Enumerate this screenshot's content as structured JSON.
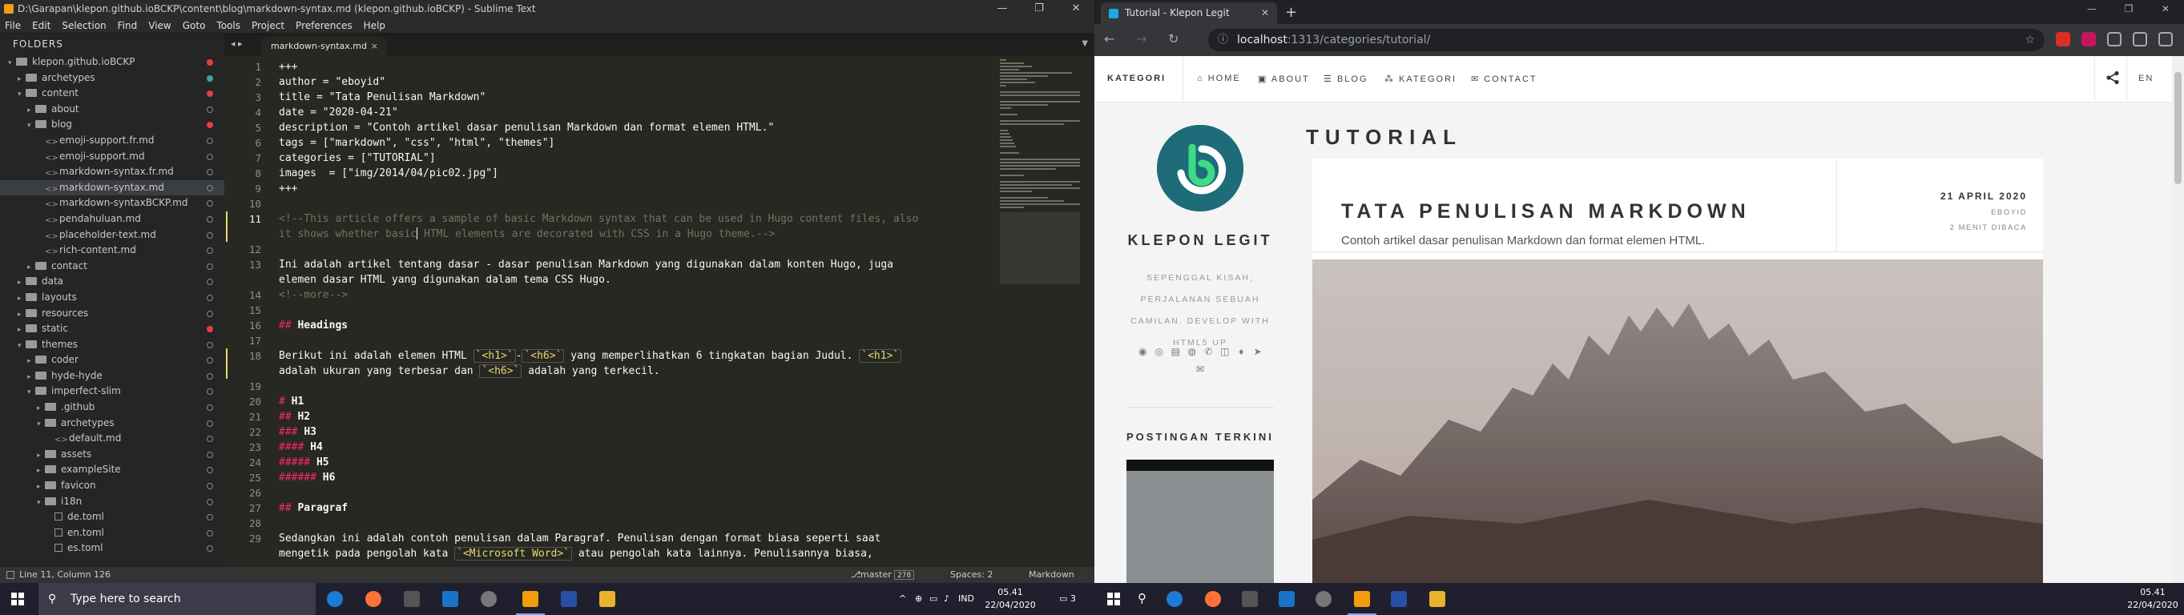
{
  "sublime": {
    "title": "D:\\Garapan\\klepon.github.ioBCKP\\content\\blog\\markdown-syntax.md (klepon.github.ioBCKP) - Sublime Text",
    "window_buttons": [
      "—",
      "❐",
      "✕"
    ],
    "menu": [
      "File",
      "Edit",
      "Selection",
      "Find",
      "View",
      "Goto",
      "Tools",
      "Project",
      "Preferences",
      "Help"
    ],
    "sidebar_header": "FOLDERS",
    "tree": [
      {
        "label": "klepon.github.ioBCKP",
        "kind": "folder",
        "depth": 0,
        "open": true,
        "dot": "red"
      },
      {
        "label": "archetypes",
        "kind": "folder",
        "depth": 1,
        "open": false,
        "dot": "teal"
      },
      {
        "label": "content",
        "kind": "folder",
        "depth": 1,
        "open": true,
        "dot": "red"
      },
      {
        "label": "about",
        "kind": "folder",
        "depth": 2,
        "open": false,
        "dot": "ring"
      },
      {
        "label": "blog",
        "kind": "folder",
        "depth": 2,
        "open": true,
        "dot": "red"
      },
      {
        "label": "emoji-support.fr.md",
        "kind": "file",
        "depth": 3,
        "dot": "ring"
      },
      {
        "label": "emoji-support.md",
        "kind": "file",
        "depth": 3,
        "dot": "ring"
      },
      {
        "label": "markdown-syntax.fr.md",
        "kind": "file",
        "depth": 3,
        "dot": "ring"
      },
      {
        "label": "markdown-syntax.md",
        "kind": "file",
        "depth": 3,
        "dot": "ring",
        "selected": true
      },
      {
        "label": "markdown-syntaxBCKP.md",
        "kind": "file",
        "depth": 3,
        "dot": "ring"
      },
      {
        "label": "pendahuluan.md",
        "kind": "file",
        "depth": 3,
        "dot": "ring"
      },
      {
        "label": "placeholder-text.md",
        "kind": "file",
        "depth": 3,
        "dot": "ring"
      },
      {
        "label": "rich-content.md",
        "kind": "file",
        "depth": 3,
        "dot": "ring"
      },
      {
        "label": "contact",
        "kind": "folder",
        "depth": 2,
        "open": false,
        "dot": "ring"
      },
      {
        "label": "data",
        "kind": "folder",
        "depth": 1,
        "open": false,
        "dot": "ring"
      },
      {
        "label": "layouts",
        "kind": "folder",
        "depth": 1,
        "open": false,
        "dot": "ring"
      },
      {
        "label": "resources",
        "kind": "folder",
        "depth": 1,
        "open": false,
        "dot": "ring"
      },
      {
        "label": "static",
        "kind": "folder",
        "depth": 1,
        "open": false,
        "dot": "red"
      },
      {
        "label": "themes",
        "kind": "folder",
        "depth": 1,
        "open": true,
        "dot": "ring"
      },
      {
        "label": "coder",
        "kind": "folder",
        "depth": 2,
        "open": false,
        "dot": "ring"
      },
      {
        "label": "hyde-hyde",
        "kind": "folder",
        "depth": 2,
        "open": false,
        "dot": "ring"
      },
      {
        "label": "imperfect-slim",
        "kind": "folder",
        "depth": 2,
        "open": true,
        "dot": "ring"
      },
      {
        "label": ".github",
        "kind": "folder",
        "depth": 3,
        "open": false,
        "dot": "ring"
      },
      {
        "label": "archetypes",
        "kind": "folder",
        "depth": 3,
        "open": true,
        "dot": "ring"
      },
      {
        "label": "default.md",
        "kind": "file",
        "depth": 4,
        "dot": "ring"
      },
      {
        "label": "assets",
        "kind": "folder",
        "depth": 3,
        "open": false,
        "dot": "ring"
      },
      {
        "label": "exampleSite",
        "kind": "folder",
        "depth": 3,
        "open": false,
        "dot": "ring"
      },
      {
        "label": "favicon",
        "kind": "folder",
        "depth": 3,
        "open": false,
        "dot": "ring"
      },
      {
        "label": "i18n",
        "kind": "folder",
        "depth": 3,
        "open": true,
        "dot": "ring"
      },
      {
        "label": "de.toml",
        "kind": "page",
        "depth": 4,
        "dot": "ring"
      },
      {
        "label": "en.toml",
        "kind": "page",
        "depth": 4,
        "dot": "ring"
      },
      {
        "label": "es.toml",
        "kind": "page",
        "depth": 4,
        "dot": "ring"
      }
    ],
    "tab_nav": "◂ ▸",
    "tab_label": "markdown-syntax.md",
    "tab_close": "×",
    "tab_dropdown": "▼",
    "active_line": 11,
    "modified_lines": [
      11,
      18
    ],
    "lines": [
      {
        "n": 1,
        "rows": [
          [
            [
              "plain",
              "+++"
            ]
          ]
        ]
      },
      {
        "n": 2,
        "rows": [
          [
            [
              "plain",
              "author = \"eboyid\""
            ]
          ]
        ]
      },
      {
        "n": 3,
        "rows": [
          [
            [
              "plain",
              "title = \"Tata Penulisan Markdown\""
            ]
          ]
        ]
      },
      {
        "n": 4,
        "rows": [
          [
            [
              "plain",
              "date = \"2020-04-21\""
            ]
          ]
        ]
      },
      {
        "n": 5,
        "rows": [
          [
            [
              "plain",
              "description = \"Contoh artikel dasar penulisan Markdown dan format elemen HTML.\""
            ]
          ]
        ]
      },
      {
        "n": 6,
        "rows": [
          [
            [
              "plain",
              "tags = [\"markdown\", \"css\", \"html\", \"themes\"]"
            ]
          ]
        ]
      },
      {
        "n": 7,
        "rows": [
          [
            [
              "plain",
              "categories = [\"TUTORIAL\"]"
            ]
          ]
        ]
      },
      {
        "n": 8,
        "rows": [
          [
            [
              "plain",
              "images  = [\"img/2014/04/pic02.jpg\"]"
            ]
          ]
        ]
      },
      {
        "n": 9,
        "rows": [
          [
            [
              "plain",
              "+++"
            ]
          ]
        ]
      },
      {
        "n": 10,
        "rows": [
          [
            [
              "plain",
              ""
            ]
          ]
        ]
      },
      {
        "n": 11,
        "rows": [
          [
            [
              "comment",
              "<!--This article offers a sample of basic Markdown syntax that can be used in Hugo content files, also"
            ]
          ],
          [
            [
              "comment",
              "it shows whether basic"
            ],
            [
              "cursor",
              ""
            ],
            [
              "comment",
              " HTML elements are decorated with CSS in a Hugo theme.-->"
            ]
          ]
        ]
      },
      {
        "n": 12,
        "rows": [
          [
            [
              "plain",
              ""
            ]
          ]
        ]
      },
      {
        "n": 13,
        "rows": [
          [
            [
              "plain",
              "Ini adalah artikel tentang dasar - dasar penulisan Markdown yang digunakan dalam konten Hugo, juga"
            ]
          ],
          [
            [
              "plain",
              "elemen dasar HTML yang digunakan dalam tema CSS Hugo."
            ]
          ]
        ]
      },
      {
        "n": 14,
        "rows": [
          [
            [
              "comment",
              "<!--more-->"
            ]
          ]
        ]
      },
      {
        "n": 15,
        "rows": [
          [
            [
              "plain",
              ""
            ]
          ]
        ]
      },
      {
        "n": 16,
        "rows": [
          [
            [
              "head",
              "## "
            ],
            [
              "bold",
              "Headings"
            ]
          ]
        ]
      },
      {
        "n": 17,
        "rows": [
          [
            [
              "plain",
              ""
            ]
          ]
        ]
      },
      {
        "n": 18,
        "rows": [
          [
            [
              "plain",
              "Berikut ini adalah elemen HTML "
            ],
            [
              "code",
              "`<h1>`"
            ],
            [
              "plain",
              "-"
            ],
            [
              "code",
              "`<h6>`"
            ],
            [
              "plain",
              " yang memperlihatkan 6 tingkatan bagian Judul. "
            ],
            [
              "code",
              "`<h1>`"
            ]
          ],
          [
            [
              "plain",
              "adalah ukuran yang terbesar dan "
            ],
            [
              "code",
              "`<h6>`"
            ],
            [
              "plain",
              " adalah yang terkecil."
            ]
          ]
        ]
      },
      {
        "n": 19,
        "rows": [
          [
            [
              "plain",
              ""
            ]
          ]
        ]
      },
      {
        "n": 20,
        "rows": [
          [
            [
              "head",
              "# "
            ],
            [
              "bold",
              "H1"
            ]
          ]
        ]
      },
      {
        "n": 21,
        "rows": [
          [
            [
              "head",
              "## "
            ],
            [
              "bold",
              "H2"
            ]
          ]
        ]
      },
      {
        "n": 22,
        "rows": [
          [
            [
              "head",
              "### "
            ],
            [
              "bold",
              "H3"
            ]
          ]
        ]
      },
      {
        "n": 23,
        "rows": [
          [
            [
              "head",
              "#### "
            ],
            [
              "bold",
              "H4"
            ]
          ]
        ]
      },
      {
        "n": 24,
        "rows": [
          [
            [
              "head",
              "##### "
            ],
            [
              "bold",
              "H5"
            ]
          ]
        ]
      },
      {
        "n": 25,
        "rows": [
          [
            [
              "head",
              "###### "
            ],
            [
              "bold",
              "H6"
            ]
          ]
        ]
      },
      {
        "n": 26,
        "rows": [
          [
            [
              "plain",
              ""
            ]
          ]
        ]
      },
      {
        "n": 27,
        "rows": [
          [
            [
              "head",
              "## "
            ],
            [
              "bold",
              "Paragraf"
            ]
          ]
        ]
      },
      {
        "n": 28,
        "rows": [
          [
            [
              "plain",
              ""
            ]
          ]
        ]
      },
      {
        "n": 29,
        "rows": [
          [
            [
              "plain",
              "Sedangkan ini adalah contoh penulisan dalam Paragraf. Penulisan dengan format biasa seperti saat"
            ]
          ],
          [
            [
              "plain",
              "mengetik pada pengolah kata "
            ],
            [
              "code",
              "`<Microsoft Word>`"
            ],
            [
              "plain",
              " atau pengolah kata lainnya. Penulisannya biasa,"
            ]
          ]
        ]
      }
    ],
    "status": {
      "position": "Line 11, Column 126",
      "branch": "master",
      "branch_badge": "278",
      "spaces": "Spaces: 2",
      "syntax": "Markdown"
    }
  },
  "browser": {
    "tab_title": "Tutorial - Klepon Legit",
    "tab_close": "✕",
    "new_tab": "+",
    "window_buttons": [
      "—",
      "❐",
      "✕"
    ],
    "url_host": "localhost",
    "url_rest": ":1313/categories/tutorial/",
    "nav": {
      "back": "←",
      "forward": "→",
      "reload": "↻",
      "info": "ⓘ",
      "star": "☆"
    },
    "site": {
      "brand": "KATEGORI",
      "menu": [
        {
          "icon": "⌂",
          "label": "HOME"
        },
        {
          "icon": "▣",
          "label": "ABOUT"
        },
        {
          "icon": "☰",
          "label": "BLOG"
        },
        {
          "icon": "⁂",
          "label": "KATEGORI"
        },
        {
          "icon": "✉",
          "label": "CONTACT"
        }
      ],
      "share_icon": "⋖",
      "lang": "EN",
      "title": "KLEPON LEGIT",
      "description": "SEPENGGAL KISAH, PERJALANAN SEBUAH CAMILAN. DEVELOP WITH HTML5 UP",
      "social_icons": [
        "◉",
        "◎",
        "▤",
        "◍",
        "✆",
        "◫",
        "♦",
        "➤",
        "✉"
      ],
      "recent_posts_title": "POSTINGAN TERKINI",
      "category_title": "TUTORIAL",
      "post": {
        "title": "TATA PENULISAN MARKDOWN",
        "description": "Contoh artikel dasar penulisan Markdown dan format elemen HTML.",
        "date": "21 APRIL 2020",
        "author": "EBOYID",
        "reading_time": "2 MENIT DIBACA"
      }
    }
  },
  "taskbar_left": {
    "search_placeholder": "Type here to search",
    "tray_text": "IND",
    "time": "05.41",
    "date": "22/04/2020",
    "notif": "3"
  },
  "taskbar_right": {
    "time": "05.41",
    "date": "22/04/2020"
  },
  "colors": {
    "sublime_bg": "#272822",
    "accent_green": "#3ddc84",
    "logo_teal": "#1e6b7a"
  }
}
